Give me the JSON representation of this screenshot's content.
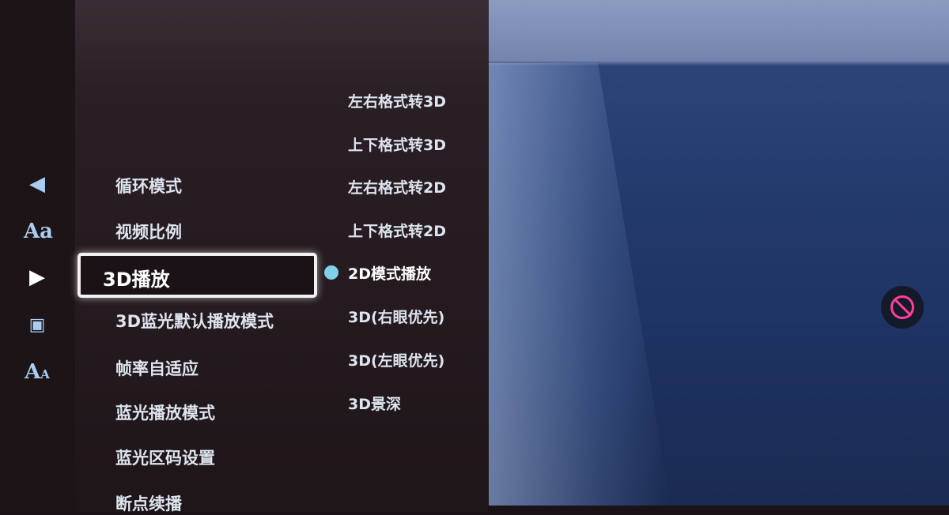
{
  "sidebar": {
    "icons": [
      "speaker-icon",
      "font-size-icon",
      "play-icon",
      "picture-icon",
      "subtitle-icon"
    ],
    "accent": "#a9cdf0"
  },
  "menu": {
    "items": [
      "循环模式",
      "视频比例",
      "3D播放",
      "3D蓝光默认播放模式",
      "帧率自适应",
      "蓝光播放模式",
      "蓝光区码设置",
      "断点续播"
    ],
    "selected": "3D播放"
  },
  "submenu": {
    "options": [
      "左右格式转3D",
      "上下格式转3D",
      "左右格式转2D",
      "上下格式转2D",
      "2D模式播放",
      "3D(右眼优先)",
      "3D(左眼优先)",
      "3D景深"
    ],
    "selected": "2D模式播放",
    "indicator_color": "#7fd0e8"
  },
  "overlay": {
    "icon": "mute-icon",
    "color": "#ff3d9a"
  }
}
